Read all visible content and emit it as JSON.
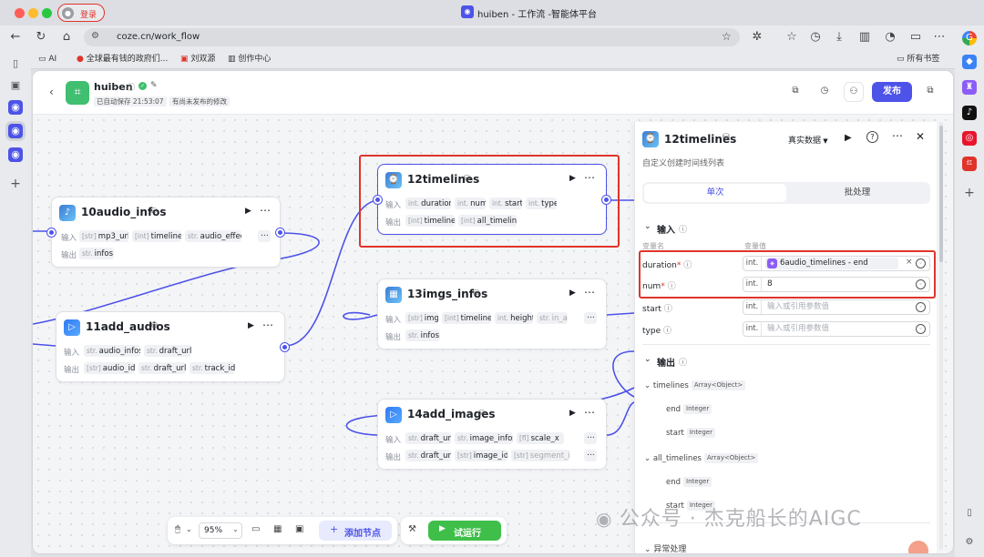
{
  "browser": {
    "tab_title": "huiben - 工作流 -智能体平台",
    "login_label": "登录",
    "url": "coze.cn/work_flow",
    "bookmarks": [
      "AI",
      "全球最有钱的政府们...",
      "刘双源",
      "创作中心"
    ],
    "bookmarks_right": "所有书签"
  },
  "app": {
    "name": "huiben",
    "autosave": "已自动保存 21:53:07",
    "unpublished": "有尚未发布的修改",
    "publish_label": "发布"
  },
  "nodes": {
    "audio_infos": {
      "title": "10audio_infos",
      "in_label": "输入",
      "out_label": "输出",
      "inputs": [
        {
          "type": "[str]",
          "name": "mp3_urls"
        },
        {
          "type": "[int]",
          "name": "timelines"
        },
        {
          "type": "str.",
          "name": "audio_effect"
        }
      ],
      "outputs": [
        {
          "type": "str.",
          "name": "infos"
        }
      ]
    },
    "add_audios": {
      "title": "11add_audios",
      "in_label": "输入",
      "out_label": "输出",
      "inputs": [
        {
          "type": "str.",
          "name": "audio_infos"
        },
        {
          "type": "str.",
          "name": "draft_url"
        }
      ],
      "outputs": [
        {
          "type": "[str]",
          "name": "audio_ids"
        },
        {
          "type": "str.",
          "name": "draft_url"
        },
        {
          "type": "str.",
          "name": "track_id"
        }
      ]
    },
    "timelines": {
      "title": "12timelines",
      "in_label": "输入",
      "out_label": "输出",
      "inputs": [
        {
          "type": "int.",
          "name": "duration"
        },
        {
          "type": "int.",
          "name": "num"
        },
        {
          "type": "int.",
          "name": "start"
        },
        {
          "type": "int.",
          "name": "type"
        }
      ],
      "outputs": [
        {
          "type": "[int]",
          "name": "timelines"
        },
        {
          "type": "[int]",
          "name": "all_timelines"
        }
      ]
    },
    "imgs_infos": {
      "title": "13imgs_infos",
      "in_label": "输入",
      "out_label": "输出",
      "inputs": [
        {
          "type": "[str]",
          "name": "imgs"
        },
        {
          "type": "[int]",
          "name": "timelines"
        },
        {
          "type": "int.",
          "name": "height"
        },
        {
          "type": "str.",
          "name": "in_an"
        }
      ],
      "outputs": [
        {
          "type": "str.",
          "name": "infos"
        }
      ]
    },
    "add_images": {
      "title": "14add_images",
      "in_label": "输入",
      "out_label": "输出",
      "inputs": [
        {
          "type": "str.",
          "name": "draft_url"
        },
        {
          "type": "str.",
          "name": "image_infos"
        },
        {
          "type": "[fl]",
          "name": "scale_x"
        }
      ],
      "outputs": [
        {
          "type": "str.",
          "name": "draft_url"
        },
        {
          "type": "[str]",
          "name": "image_ids"
        },
        {
          "type": "[str]",
          "name": "segment_ids"
        }
      ]
    }
  },
  "panel": {
    "title": "12timelines",
    "data_mode": "真实数据",
    "description": "自定义创建时间线列表",
    "tab_single": "单次",
    "tab_batch": "批处理",
    "input_section": "输入",
    "col_name": "变量名",
    "col_value": "变量值",
    "params": [
      {
        "name": "duration",
        "required": true,
        "type": "int.",
        "value": "6audio_timelines - end"
      },
      {
        "name": "num",
        "required": true,
        "type": "int.",
        "value": "8"
      },
      {
        "name": "start",
        "required": false,
        "type": "int.",
        "placeholder": "输入或引用参数值"
      },
      {
        "name": "type",
        "required": false,
        "type": "int.",
        "placeholder": "输入或引用参数值"
      }
    ],
    "output_section": "输出",
    "outputs": [
      {
        "name": "timelines",
        "type": "Array<Object>",
        "children": [
          {
            "name": "end",
            "type": "Integer"
          },
          {
            "name": "start",
            "type": "Integer"
          }
        ]
      },
      {
        "name": "all_timelines",
        "type": "Array<Object>",
        "children": [
          {
            "name": "end",
            "type": "Integer"
          },
          {
            "name": "start",
            "type": "Integer"
          }
        ]
      }
    ],
    "error_section": "异常处理"
  },
  "bottombar": {
    "zoom": "95%",
    "add_node": "添加节点",
    "test_run": "试运行"
  },
  "watermark": "公众号 · 杰克船长的AIGC"
}
